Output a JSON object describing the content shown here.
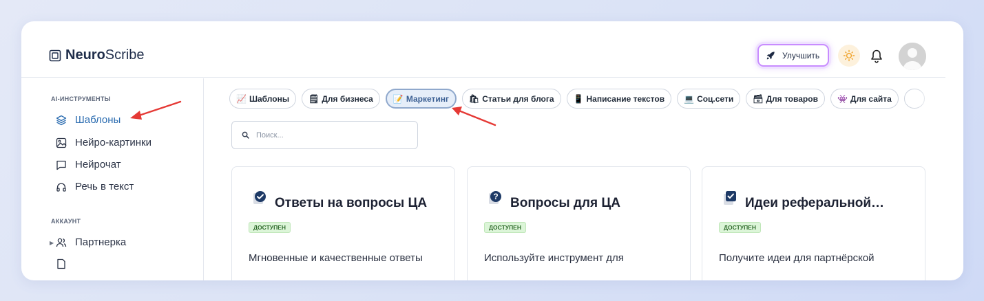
{
  "app": {
    "logo_bold": "Neuro",
    "logo_light": "Scribe"
  },
  "header": {
    "upgrade_label": "Улучшить"
  },
  "sidebar": {
    "tools_title": "AI-ИНСТРУМЕНТЫ",
    "tools": [
      {
        "label": "Шаблоны",
        "icon": "layers-icon",
        "active": true
      },
      {
        "label": "Нейро-картинки",
        "icon": "image-icon"
      },
      {
        "label": "Нейрочат",
        "icon": "chat-icon"
      },
      {
        "label": "Речь в текст",
        "icon": "headphones-icon"
      }
    ],
    "account_title": "АККАУНТ",
    "account": [
      {
        "label": "Партнерка",
        "icon": "users-icon"
      }
    ]
  },
  "chips": [
    {
      "icon": "📈",
      "label": "Шаблоны"
    },
    {
      "icon": "🗒",
      "label": "Для бизнеса"
    },
    {
      "icon": "📝",
      "label": "Маркетинг",
      "active": true
    },
    {
      "icon": "🛍",
      "label": "Статьи для блога"
    },
    {
      "icon": "📱",
      "label": "Написание текстов"
    },
    {
      "icon": "💻",
      "label": "Соц.сети"
    },
    {
      "icon": "🗃",
      "label": "Для товаров"
    },
    {
      "icon": "👾",
      "label": "Для сайта"
    }
  ],
  "search": {
    "placeholder": "Поиск..."
  },
  "cards": [
    {
      "title": "Ответы на вопросы ЦА",
      "badge": "ДОСТУПЕН",
      "desc": "Мгновенные и качественные ответы",
      "icon": "check-circle-icon"
    },
    {
      "title": "Вопросы для ЦА",
      "badge": "ДОСТУПЕН",
      "desc": "Используйте инструмент для",
      "icon": "question-circle-icon"
    },
    {
      "title": "Идеи реферальной…",
      "badge": "ДОСТУПЕН",
      "desc": "Получите идеи для партнёрской",
      "icon": "checkbox-icon"
    }
  ],
  "colors": {
    "accent": "#2b6cb0",
    "badge_bg": "#dcf5d8",
    "arrow": "#e53935",
    "upgrade_glow": "#c88cff"
  }
}
